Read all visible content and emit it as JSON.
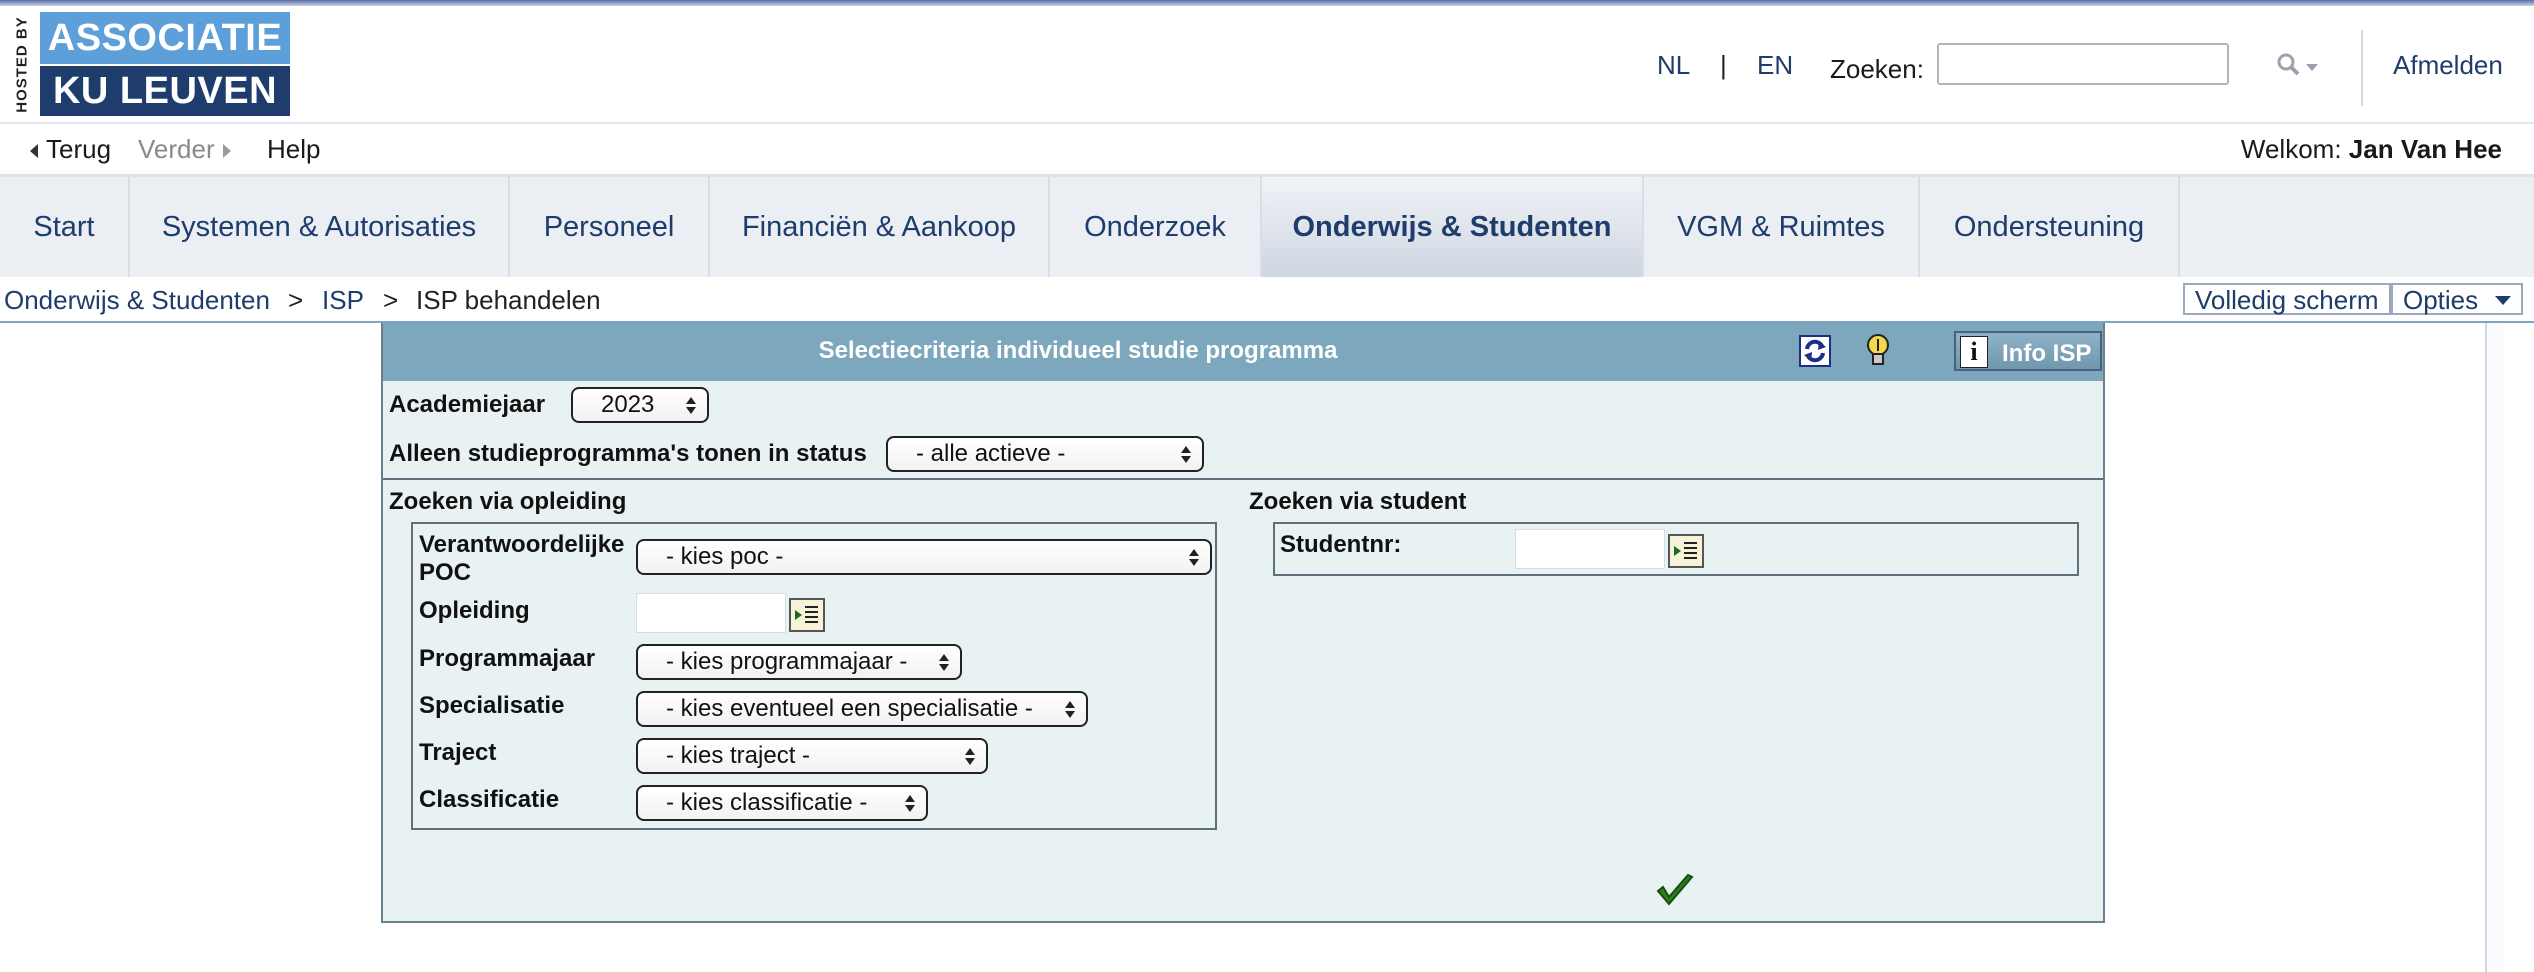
{
  "header": {
    "hosted_by": "HOSTED BY",
    "logo_line1": "ASSOCIATIE",
    "logo_line2": "KU LEUVEN",
    "lang_nl": "NL",
    "lang_sep": "|",
    "lang_en": "EN",
    "search_label": "Zoeken:",
    "search_value": "",
    "logout": "Afmelden"
  },
  "nav": {
    "back": "Terug",
    "forward": "Verder",
    "help": "Help",
    "welcome_label": "Welkom:",
    "user_name": "Jan Van Hee"
  },
  "tabs": [
    {
      "label": "Start"
    },
    {
      "label": "Systemen & Autorisaties"
    },
    {
      "label": "Personeel"
    },
    {
      "label": "Financiën & Aankoop"
    },
    {
      "label": "Onderzoek"
    },
    {
      "label": "Onderwijs & Studenten",
      "active": true
    },
    {
      "label": "VGM & Ruimtes"
    },
    {
      "label": "Ondersteuning"
    }
  ],
  "breadcrumb": {
    "items": [
      "Onderwijs & Studenten",
      "ISP",
      "ISP behandelen"
    ],
    "separator": ">"
  },
  "toolbar": {
    "fullscreen": "Volledig scherm",
    "options": "Opties"
  },
  "panel": {
    "title": "Selectiecriteria individueel studie programma",
    "info_button": "Info ISP",
    "academiejaar_label": "Academiejaar",
    "academiejaar_value": "2023",
    "status_label": "Alleen studieprogramma's tonen in status",
    "status_value": "- alle actieve -",
    "opleiding_section": "Zoeken via opleiding",
    "student_section": "Zoeken via student",
    "poc_label_1": "Verantwoordelijke",
    "poc_label_2": "POC",
    "poc_value": "- kies poc -",
    "opleiding_label": "Opleiding",
    "opleiding_value": "",
    "programmajaar_label": "Programmajaar",
    "programmajaar_value": "- kies programmajaar -",
    "specialisatie_label": "Specialisatie",
    "specialisatie_value": "- kies eventueel een specialisatie -",
    "traject_label": "Traject",
    "traject_value": "- kies traject -",
    "classificatie_label": "Classificatie",
    "classificatie_value": "- kies classificatie -",
    "studentnr_label": "Studentnr:",
    "studentnr_value": ""
  },
  "colors": {
    "brand_dark": "#1e3c6c",
    "brand_light": "#5d9fd9",
    "panel_header": "#7da7bc",
    "panel_bg": "#e9f2f3"
  }
}
